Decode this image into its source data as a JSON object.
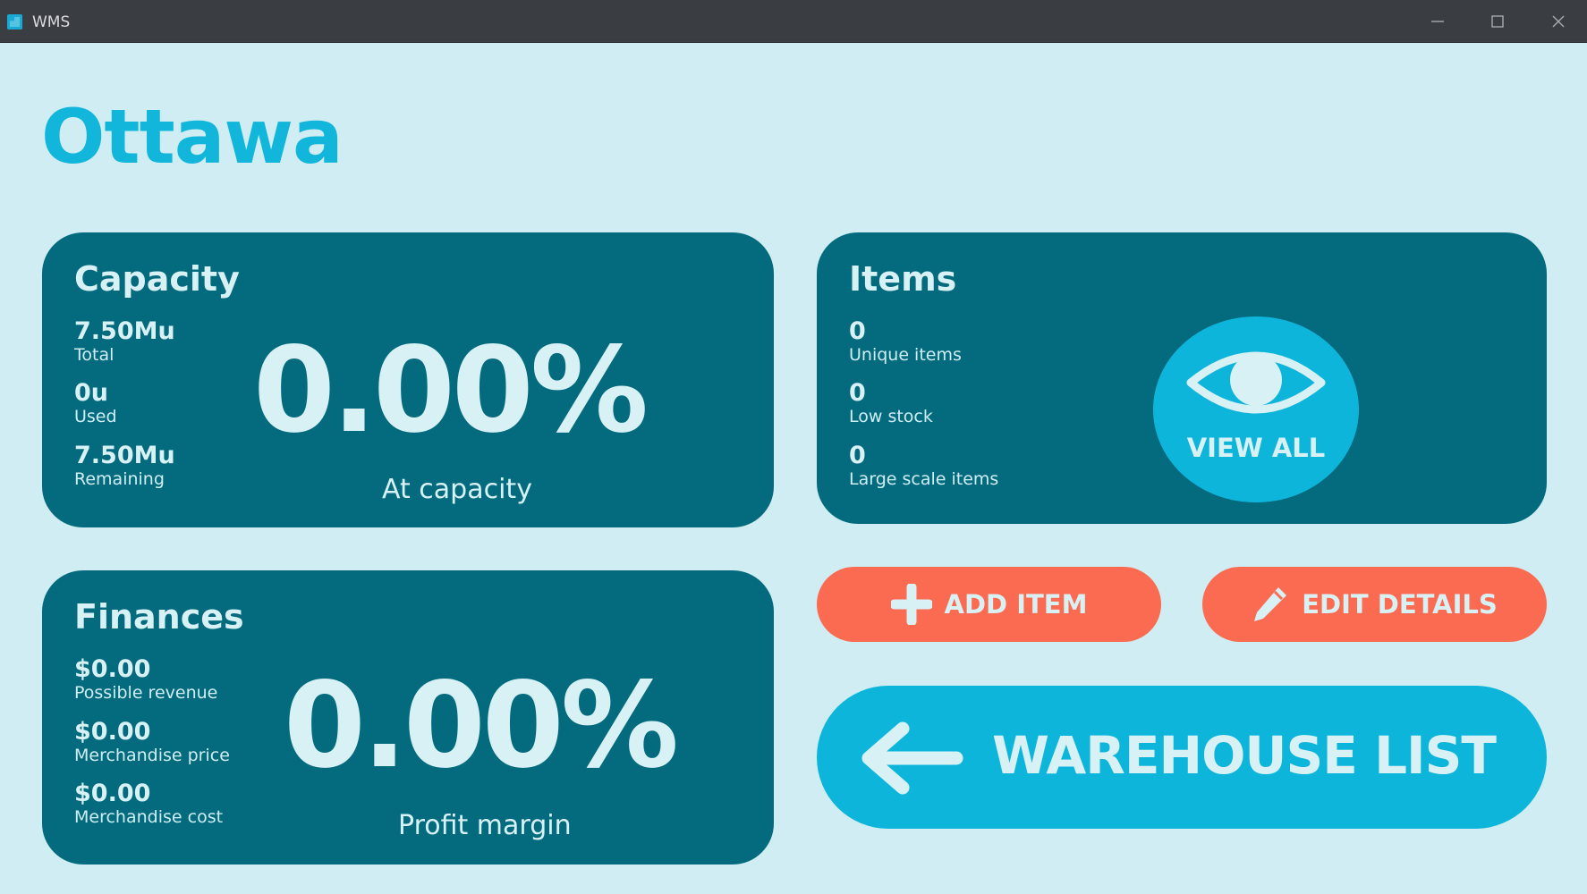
{
  "window": {
    "title": "WMS"
  },
  "page": {
    "title": "Ottawa"
  },
  "capacity": {
    "title": "Capacity",
    "total_value": "7.50Mu",
    "total_label": "Total",
    "used_value": "0u",
    "used_label": "Used",
    "remaining_value": "7.50Mu",
    "remaining_label": "Remaining",
    "percent": "0.00%",
    "percent_label": "At capacity"
  },
  "finances": {
    "title": "Finances",
    "revenue_value": "$0.00",
    "revenue_label": "Possible revenue",
    "price_value": "$0.00",
    "price_label": "Merchandise price",
    "cost_value": "$0.00",
    "cost_label": "Merchandise cost",
    "percent": "0.00%",
    "percent_label": "Profit margin"
  },
  "items": {
    "title": "Items",
    "unique_value": "0",
    "unique_label": "Unique items",
    "low_stock_value": "0",
    "low_stock_label": "Low stock",
    "large_value": "0",
    "large_label": "Large scale items",
    "view_all_label": "VIEW ALL",
    "view_all_icon": "eye-icon"
  },
  "actions": {
    "add_item_label": "ADD ITEM",
    "add_item_icon": "plus-icon",
    "edit_details_label": "EDIT DETAILS",
    "edit_details_icon": "pencil-icon",
    "warehouse_list_label": "WAREHOUSE LIST",
    "warehouse_list_icon": "arrow-left-icon"
  },
  "colors": {
    "background": "#cfedf2",
    "title_accent": "#11b6da",
    "card": "#046b7f",
    "primary_button": "#0eb5db",
    "action_button": "#fa6b52",
    "card_text": "#d7f1f5",
    "titlebar": "#3a3d42"
  }
}
